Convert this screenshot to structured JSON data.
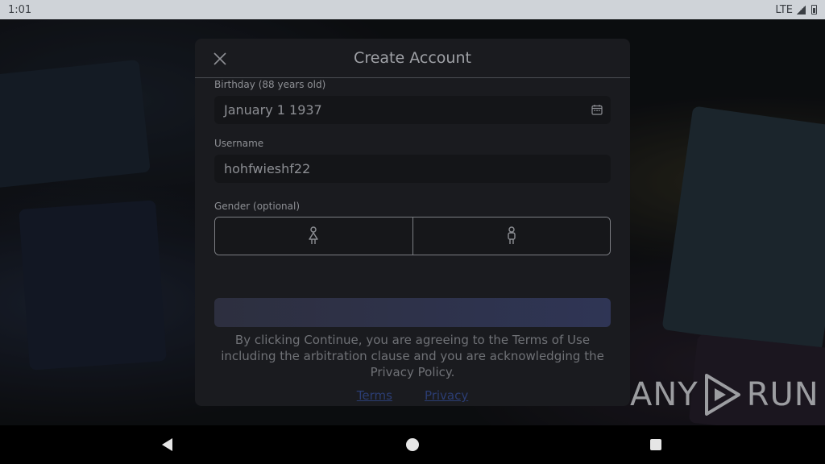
{
  "status_bar": {
    "time": "1:01",
    "network": "LTE"
  },
  "modal": {
    "title": "Create Account",
    "birthday": {
      "label": "Birthday (88 years old)",
      "value": "January 1 1937"
    },
    "username": {
      "label": "Username",
      "value": "hohfwieshf22"
    },
    "gender": {
      "label": "Gender (optional)"
    },
    "legal_text": "By clicking Continue, you are agreeing to the Terms of Use including the arbitration clause and you are acknowledging the Privacy Policy.",
    "links": {
      "terms": "Terms",
      "privacy": "Privacy"
    }
  },
  "watermark": {
    "left": "ANY",
    "right": "RUN"
  },
  "colors": {
    "modal_bg": "#1a1b1f",
    "link": "#2b3d73",
    "continue_start": "#2d2f3f",
    "continue_end": "#2f3555"
  }
}
